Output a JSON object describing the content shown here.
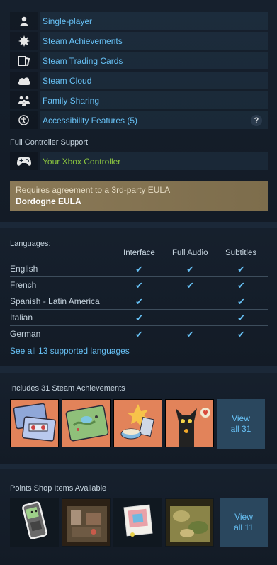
{
  "features": [
    {
      "label": "Single-player",
      "icon": "person-icon"
    },
    {
      "label": "Steam Achievements",
      "icon": "achievement-burst-icon"
    },
    {
      "label": "Steam Trading Cards",
      "icon": "trading-cards-icon"
    },
    {
      "label": "Steam Cloud",
      "icon": "cloud-icon"
    },
    {
      "label": "Family Sharing",
      "icon": "family-icon"
    },
    {
      "label": "Accessibility Features (5)",
      "icon": "accessibility-icon",
      "help": "?"
    }
  ],
  "controller": {
    "title": "Full Controller Support",
    "label": "Your Xbox Controller",
    "icon": "gamepad-icon"
  },
  "eula": {
    "line1": "Requires agreement to a 3rd-party EULA",
    "line2": "Dordogne EULA"
  },
  "languages": {
    "title": "Languages:",
    "columns": [
      "Interface",
      "Full Audio",
      "Subtitles"
    ],
    "rows": [
      {
        "name": "English",
        "interface": true,
        "audio": true,
        "subtitles": true
      },
      {
        "name": "French",
        "interface": true,
        "audio": true,
        "subtitles": true
      },
      {
        "name": "Spanish - Latin America",
        "interface": true,
        "audio": false,
        "subtitles": true
      },
      {
        "name": "Italian",
        "interface": true,
        "audio": false,
        "subtitles": true
      },
      {
        "name": "German",
        "interface": true,
        "audio": true,
        "subtitles": true
      }
    ],
    "check_glyph": "✔",
    "see_all": "See all 13 supported languages"
  },
  "achievements": {
    "title": "Includes 31 Steam Achievements",
    "view_all_line1": "View",
    "view_all_line2": "all 31"
  },
  "points_shop": {
    "title": "Points Shop Items Available",
    "view_all_line1": "View",
    "view_all_line2": "all 11"
  },
  "colors": {
    "link": "#67c1f5",
    "controller_green": "#8bc53f",
    "eula_bg": "#7f6f4f",
    "panel_bg": "#16202d",
    "page_bg": "#1b2838"
  }
}
